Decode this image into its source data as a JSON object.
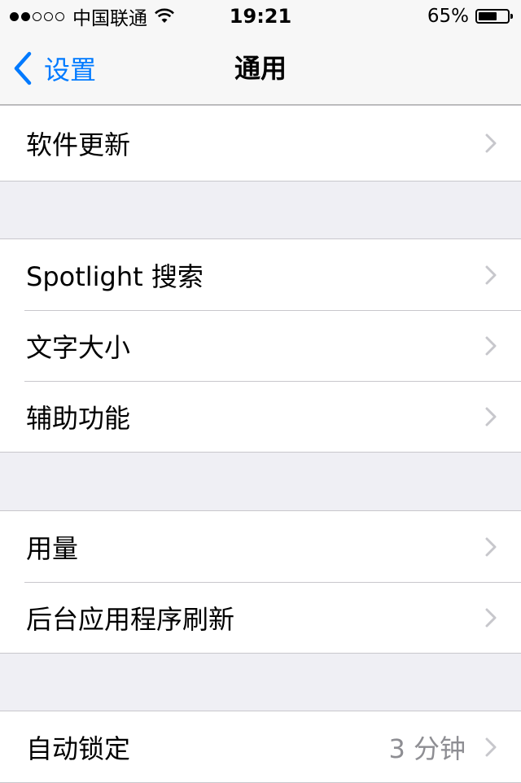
{
  "status_bar": {
    "carrier": "中国联通",
    "time": "19:21",
    "battery_percent": "65%",
    "battery_level": 0.65,
    "signal_bars_filled": 2,
    "signal_bars_total": 5
  },
  "nav": {
    "back_label": "设置",
    "title": "通用"
  },
  "sections": {
    "top": [
      {
        "label": "软件更新"
      }
    ],
    "group2": [
      {
        "label": "Spotlight 搜索"
      },
      {
        "label": "文字大小"
      },
      {
        "label": "辅助功能"
      }
    ],
    "group3": [
      {
        "label": "用量"
      },
      {
        "label": "后台应用程序刷新"
      }
    ],
    "group4": [
      {
        "label": "自动锁定",
        "value": "3 分钟"
      }
    ]
  },
  "colors": {
    "accent": "#007aff",
    "background": "#efeff4",
    "separator": "#c8c7cc",
    "chevron": "#c7c7cc",
    "secondary_text": "#8e8e93"
  },
  "icons": {
    "back": "chevron-left-icon",
    "disclosure": "chevron-right-icon",
    "wifi": "wifi-icon",
    "battery": "battery-icon"
  }
}
